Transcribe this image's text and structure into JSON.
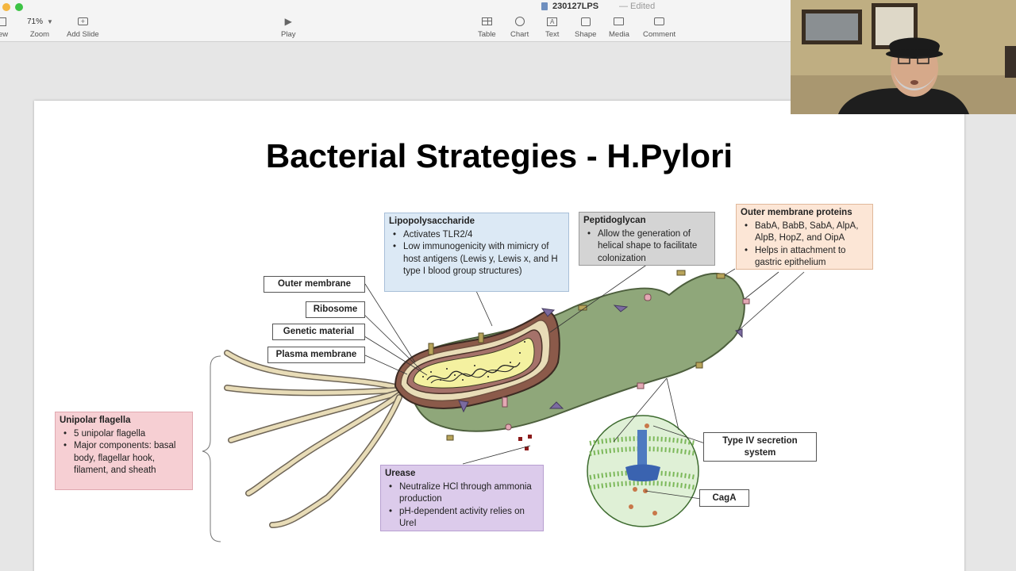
{
  "window": {
    "doc_title": "230127LPS",
    "doc_status": "— Edited"
  },
  "toolbar": {
    "view_label": "ew",
    "zoom_value": "71%",
    "zoom_label": "Zoom",
    "add_slide_label": "Add Slide",
    "play_label": "Play",
    "table_label": "Table",
    "chart_label": "Chart",
    "text_label": "Text",
    "shape_label": "Shape",
    "media_label": "Media",
    "comment_label": "Comment"
  },
  "slide": {
    "title": "Bacterial Strategies - H.Pylori",
    "labels": {
      "outer_membrane": "Outer membrane",
      "ribosome": "Ribosome",
      "genetic_material": "Genetic material",
      "plasma_membrane": "Plasma membrane",
      "type_iv_1": "Type IV secretion",
      "type_iv_2": "system",
      "caga": "CagA"
    },
    "lps": {
      "title": "Lipopolysaccharide",
      "items": [
        "Activates TLR2/4",
        "Low immunogenicity with mimicry of host antigens (Lewis y, Lewis x, and H type I blood group structures)"
      ]
    },
    "peptidoglycan": {
      "title": "Peptidoglycan",
      "items": [
        "Allow the generation of helical shape to facilitate colonization"
      ]
    },
    "omp": {
      "title": "Outer membrane proteins",
      "items": [
        "BabA, BabB, SabA, AlpA, AlpB, HopZ, and OipA",
        "Helps in attachment to gastric epithelium"
      ]
    },
    "flagella": {
      "title": "Unipolar flagella",
      "items": [
        "5 unipolar flagella",
        "Major components: basal body, flagellar hook, filament, and sheath"
      ]
    },
    "urease": {
      "title": "Urease",
      "items": [
        "Neutralize HCl through ammonia production",
        "pH-dependent activity relies on UreI"
      ]
    },
    "colors": {
      "lps_bg": "#dce9f5",
      "peptidoglycan_bg": "#d4d4d4",
      "omp_bg": "#fce6d6",
      "flagella_bg": "#f6cfd3",
      "urease_bg": "#dccbeb",
      "body_green": "#8fa77a"
    }
  }
}
